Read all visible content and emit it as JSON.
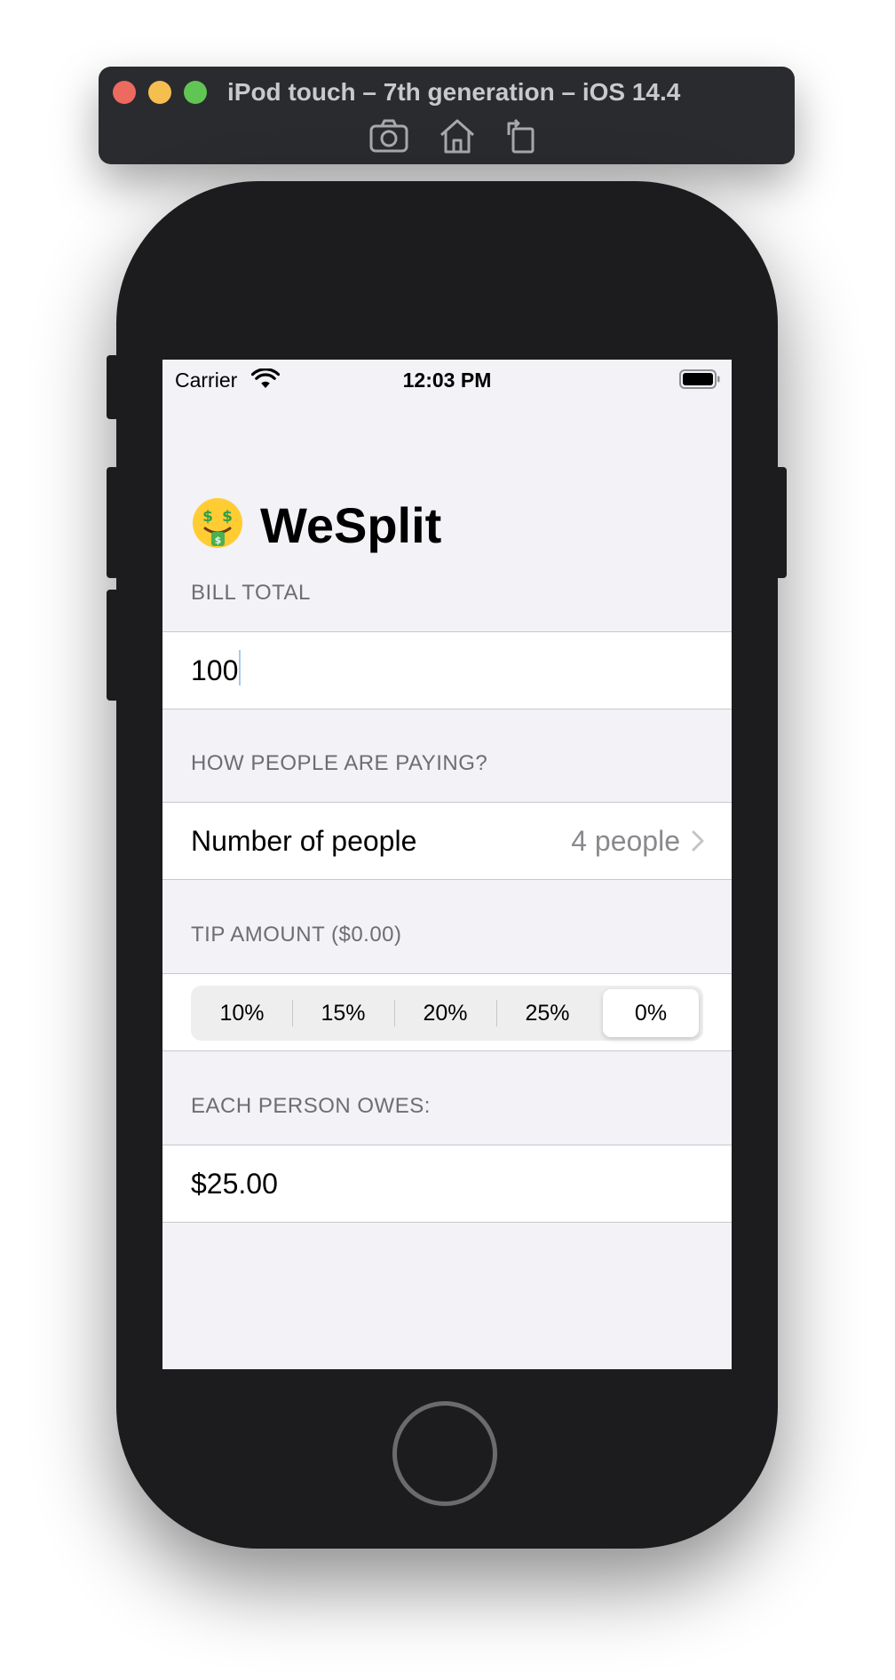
{
  "simulator": {
    "title": "iPod touch – 7th generation – iOS 14.4",
    "tools": [
      "screenshot-icon",
      "home-icon",
      "rotate-icon"
    ]
  },
  "status_bar": {
    "carrier": "Carrier",
    "time": "12:03 PM",
    "icons": [
      "wifi-icon",
      "battery-icon"
    ]
  },
  "nav": {
    "title": "WeSplit",
    "icon": "money-mouth-face-emoji"
  },
  "form": {
    "bill": {
      "header": "BILL TOTAL",
      "value": "100"
    },
    "people": {
      "header": "HOW PEOPLE ARE PAYING?",
      "label": "Number of people",
      "value": "4 people"
    },
    "tip": {
      "header": "TIP AMOUNT ($0.00)",
      "options": [
        "10%",
        "15%",
        "20%",
        "25%",
        "0%"
      ],
      "selected": "0%"
    },
    "result": {
      "header": "EACH PERSON OWES:",
      "value": "$25.00"
    }
  },
  "colors": {
    "background": "#f2f2f7",
    "section_header": "#6d6d72",
    "secondary_value": "#8a8a8e",
    "device": "#1c1c1e"
  }
}
